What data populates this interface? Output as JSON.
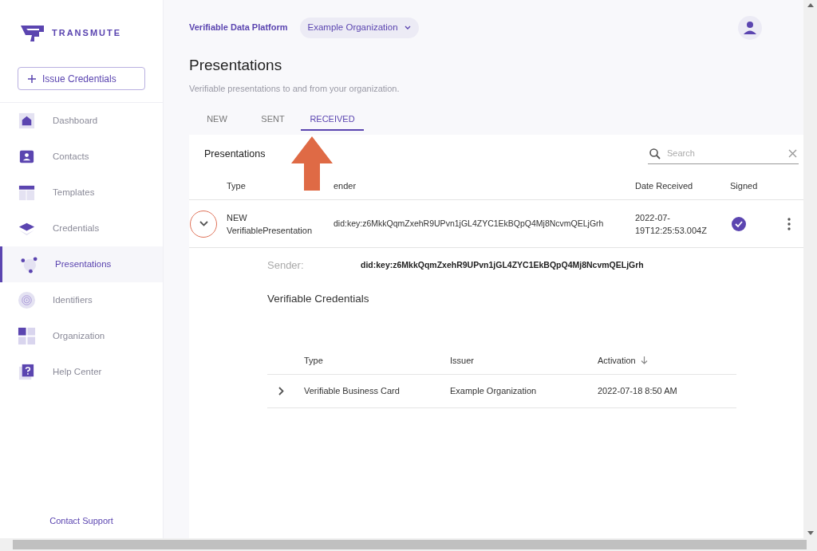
{
  "sidebar": {
    "logo_text": "TRANSMUTE",
    "issue_button": "Issue Credentials",
    "items": [
      {
        "label": "Dashboard",
        "selected": false
      },
      {
        "label": "Contacts",
        "selected": false
      },
      {
        "label": "Templates",
        "selected": false
      },
      {
        "label": "Credentials",
        "selected": false
      },
      {
        "label": "Presentations",
        "selected": true
      },
      {
        "label": "Identifiers",
        "selected": false
      },
      {
        "label": "Organization",
        "selected": false
      },
      {
        "label": "Help Center",
        "selected": false
      }
    ],
    "footer_link": "Contact Support"
  },
  "header": {
    "platform": "Verifiable Data Platform",
    "organization": "Example Organization"
  },
  "page": {
    "title": "Presentations",
    "subtitle": "Verifiable presentations to and from your organization."
  },
  "tabs": [
    {
      "label": "NEW",
      "selected": false
    },
    {
      "label": "SENT",
      "selected": false
    },
    {
      "label": "RECEIVED",
      "selected": true
    }
  ],
  "table": {
    "title": "Presentations",
    "search": {
      "placeholder": "Search"
    },
    "columns": [
      "Type",
      "ender",
      "Date Received",
      "Signed"
    ],
    "rows": [
      {
        "type_lines": [
          "NEW",
          "VerifiablePresentation"
        ],
        "sender": "did:key:z6MkkQqmZxehR9UPvn1jGL4ZYC1EkBQpQ4Mj8NcvmQELjGrh",
        "date": "2022-07-19T12:25:53.004Z",
        "signed": true,
        "expanded": true,
        "detail": {
          "sender_label": "Sender:",
          "sender": "did:key:z6MkkQqmZxehR9UPvn1jGL4ZYC1EkBQpQ4Mj8NcvmQELjGrh",
          "section_title": "Verifiable Credentials",
          "columns": [
            "Type",
            "Issuer",
            "Activation"
          ],
          "rows": [
            {
              "type": "Verifiable Business Card",
              "issuer": "Example Organization",
              "activation": "2022-07-18 8:50 AM",
              "expanded": false
            }
          ]
        }
      }
    ]
  }
}
